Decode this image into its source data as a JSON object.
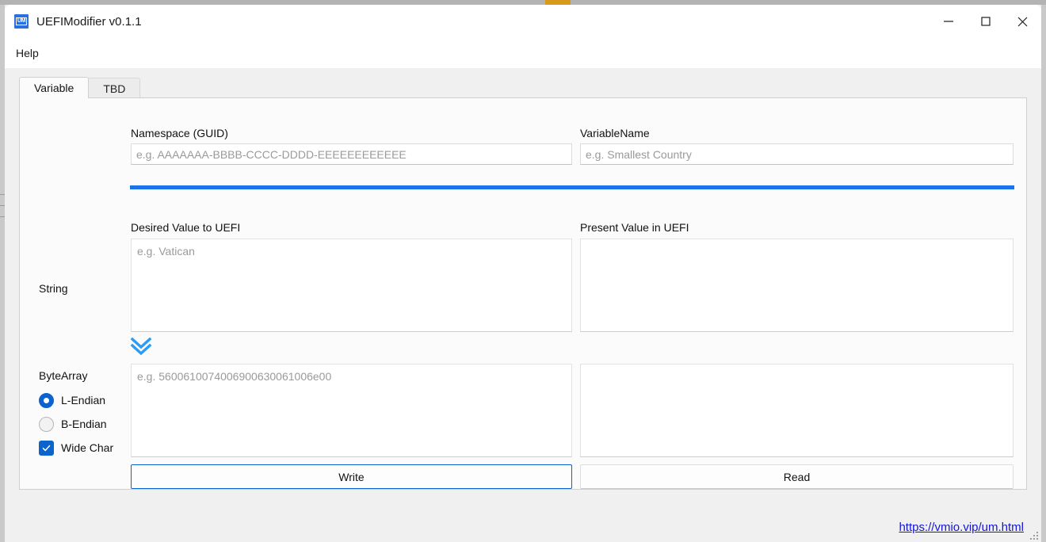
{
  "window": {
    "title": "UEFIModifier v0.1.1",
    "icon_name": "app-logo-um-icon",
    "icon_text": "UM",
    "controls": {
      "minimize": "minimize-icon",
      "maximize": "maximize-icon",
      "close": "close-icon"
    }
  },
  "menubar": {
    "items": [
      {
        "label": "Help"
      }
    ]
  },
  "tabs": [
    {
      "label": "Variable",
      "active": true
    },
    {
      "label": "TBD",
      "active": false
    }
  ],
  "form": {
    "namespace": {
      "label": "Namespace (GUID)",
      "value": "",
      "placeholder": "e.g. AAAAAAA-BBBB-CCCC-DDDD-EEEEEEEEEEEE"
    },
    "variable_name": {
      "label": "VariableName",
      "value": "",
      "placeholder": "e.g. Smallest Country"
    },
    "desired_value": {
      "label": "Desired Value to UEFI"
    },
    "present_value": {
      "label": "Present Value in UEFI"
    },
    "string_row": {
      "label": "String",
      "desired_value": "",
      "desired_placeholder": "e.g. Vatican",
      "present_value": "",
      "present_placeholder": ""
    },
    "convert_icon": "double-chevron-down-icon",
    "bytearray_row": {
      "label": "ByteArray",
      "desired_value": "",
      "desired_placeholder": "e.g. 5600610074006900630061006e00",
      "present_value": "",
      "present_placeholder": ""
    },
    "endian_options": [
      {
        "label": "L-Endian",
        "selected": true
      },
      {
        "label": "B-Endian",
        "selected": false
      }
    ],
    "wide_char": {
      "label": "Wide Char",
      "checked": true
    },
    "buttons": {
      "write": "Write",
      "read": "Read"
    }
  },
  "footer": {
    "link": "https://vmio.vip/um.html",
    "grip_name": "resize-grip"
  },
  "colors": {
    "accent": "#1a73e8",
    "control_accent": "#0b63ce",
    "link": "#1414d8",
    "window_bg": "#f0f0f0",
    "panel_bg": "#fbfbfb"
  }
}
